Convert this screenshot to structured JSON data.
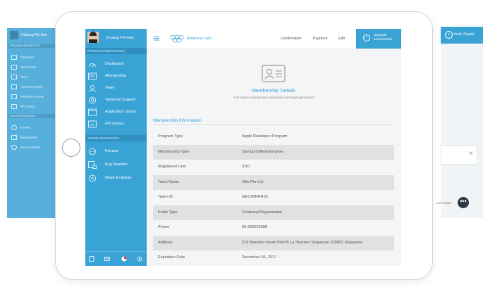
{
  "background_left": {
    "user_name": "Chuang Pei-Han",
    "section_program": "PROGRAM RESOURCES",
    "items_program": [
      "Dashboard",
      "Membership",
      "Team",
      "Technical Support",
      "Application Library",
      "API Library"
    ],
    "section_other": "OTHER RESOURCES",
    "items_other": [
      "Forums",
      "Bug Reporter",
      "News & Update"
    ]
  },
  "background_right": {
    "invite_label": "Invite People",
    "chat_label": "Live Chat •"
  },
  "sidebar": {
    "user_name": "Chuang Pei-Han",
    "section_program": "PROGRAM RESOURCES",
    "items_program": [
      {
        "label": "Dashboard",
        "icon": "dashboard-icon"
      },
      {
        "label": "Membership",
        "icon": "membership-icon"
      },
      {
        "label": "Team",
        "icon": "team-icon"
      },
      {
        "label": "Technical Support",
        "icon": "support-icon"
      },
      {
        "label": "Application Library",
        "icon": "app-library-icon"
      },
      {
        "label": "API Library",
        "icon": "api-icon"
      }
    ],
    "section_other": "OTHER RESOURCES",
    "items_other": [
      {
        "label": "Forums",
        "icon": "forums-icon"
      },
      {
        "label": "Bug Reporter",
        "icon": "bug-reporter-icon"
      },
      {
        "label": "News & Update",
        "icon": "news-icon"
      }
    ],
    "footer_icons": [
      "document-icon",
      "mail-icon",
      "user-flag-icon",
      "settings-icon"
    ]
  },
  "topbar": {
    "brand": "Morpheus Labs",
    "nav": [
      "Confirmation",
      "Payment",
      "Edit"
    ],
    "upgrade_line1": "Upgrade",
    "upgrade_line2": "Membership"
  },
  "hero": {
    "title": "Membership Details",
    "subtitle": "Your team's membership information and legal agreements"
  },
  "section_title": "Membership Information",
  "rows": [
    {
      "key": "Program Type",
      "value": "Apple Developer Program"
    },
    {
      "key": "Membership Type",
      "value": "Startup/SME/Enterprise"
    },
    {
      "key": "Registered User",
      "value": "3/10"
    },
    {
      "key": "Team Name",
      "value": "Otto Pte Ltd"
    },
    {
      "key": "Team ID",
      "value": "MEC66HPH36"
    },
    {
      "key": "Entity Type",
      "value": "Company/Organization"
    },
    {
      "key": "Phone",
      "value": "65-906605088"
    },
    {
      "key": "Address",
      "value": "519 Balestier Road #04-05 La Shantier Singapore 329852 Singapore"
    },
    {
      "key": "Expiration Date",
      "value": "December 05, 2017"
    }
  ],
  "colors": {
    "accent": "#3aa3d6",
    "accent_dark": "#2e8fc0",
    "row_alt": "#dfe1e3"
  }
}
